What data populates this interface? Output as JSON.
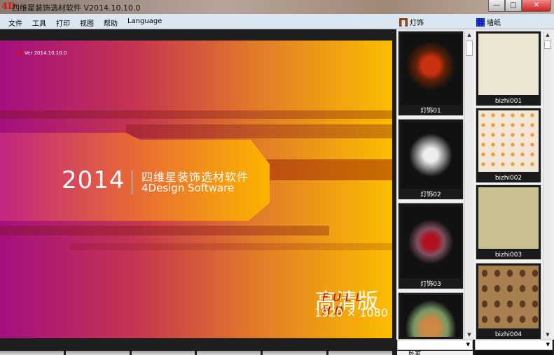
{
  "window": {
    "logo": "4D",
    "title": "四维星装饰选材软件 V2014.10.10.0",
    "minimize": "—",
    "maximize": "□",
    "close": "✕"
  },
  "menu": [
    "文件",
    "工具",
    "打印",
    "视图",
    "帮助",
    "Language"
  ],
  "panels": {
    "lights": {
      "title": "灯饰",
      "icon": "chair-icon",
      "items": [
        "灯饰01",
        "灯饰02",
        "灯饰03",
        ""
      ]
    },
    "wallpaper": {
      "title": "墙纸",
      "icon": "wallpaper-icon",
      "items": [
        "bizhi001",
        "bizhi002",
        "bizhi003",
        "bizhi004"
      ]
    }
  },
  "splash": {
    "version": "Ver 2014.10.10.0",
    "year": "2014",
    "name_cn": "四维星装饰选材软件",
    "name_en": "4Design Software",
    "edition": "高清版",
    "edition_en": "FULL HD",
    "resolution": "1920 × 1080"
  },
  "bottom": {
    "category": "卧室"
  },
  "colors": {
    "menubar": "#dbe6f3",
    "accent": "#e01010"
  }
}
